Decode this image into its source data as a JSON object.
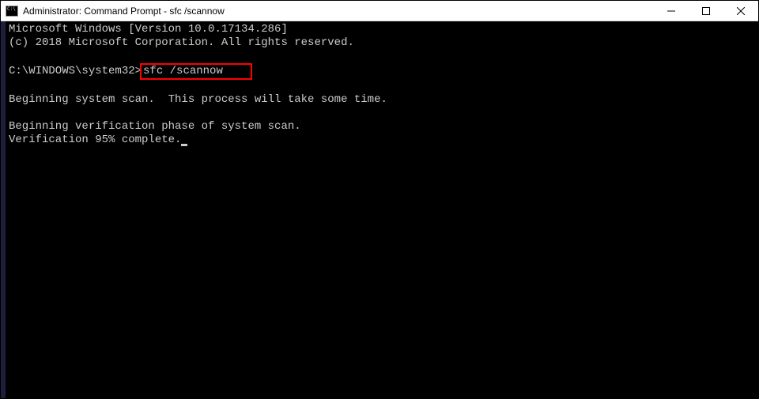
{
  "titlebar": {
    "title": "Administrator: Command Prompt - sfc  /scannow"
  },
  "terminal": {
    "line1": "Microsoft Windows [Version 10.0.17134.286]",
    "line2": "(c) 2018 Microsoft Corporation. All rights reserved.",
    "prompt": "C:\\WINDOWS\\system32>",
    "command": "sfc /scannow",
    "msg1": "Beginning system scan.  This process will take some time.",
    "msg2": "Beginning verification phase of system scan.",
    "msg3": "Verification 95% complete."
  }
}
